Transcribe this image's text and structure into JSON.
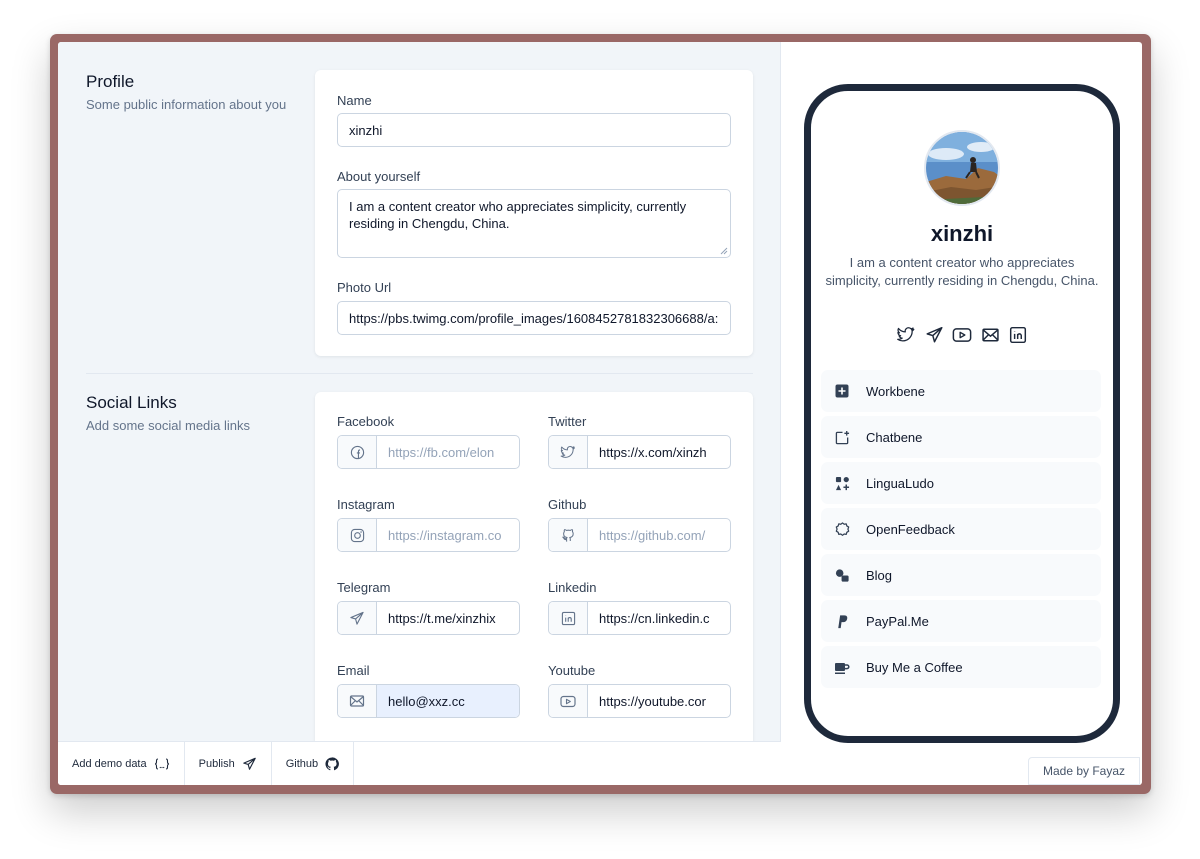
{
  "profile": {
    "title": "Profile",
    "subtitle": "Some public information about you",
    "name_label": "Name",
    "name_value": "xinzhi",
    "about_label": "About yourself",
    "about_value": "I am a content creator who appreciates simplicity, currently residing in Chengdu, China.",
    "photo_label": "Photo Url",
    "photo_value": "https://pbs.twimg.com/profile_images/1608452781832306688/a:"
  },
  "social": {
    "title": "Social Links",
    "subtitle": "Add some social media links",
    "fields": {
      "facebook": {
        "label": "Facebook",
        "value": "https://fb.com/elon",
        "icon": "facebook-icon",
        "placeholder": true
      },
      "twitter": {
        "label": "Twitter",
        "value": "https://x.com/xinzh",
        "icon": "twitter-icon",
        "placeholder": false
      },
      "instagram": {
        "label": "Instagram",
        "value": "https://instagram.co",
        "icon": "instagram-icon",
        "placeholder": true
      },
      "github": {
        "label": "Github",
        "value": "https://github.com/",
        "icon": "github-icon",
        "placeholder": true
      },
      "telegram": {
        "label": "Telegram",
        "value": "https://t.me/xinzhix",
        "icon": "telegram-icon",
        "placeholder": false
      },
      "linkedin": {
        "label": "Linkedin",
        "value": "https://cn.linkedin.c",
        "icon": "linkedin-icon",
        "placeholder": false
      },
      "email": {
        "label": "Email",
        "value": "hello@xxz.cc",
        "icon": "mail-icon",
        "placeholder": false
      },
      "youtube": {
        "label": "Youtube",
        "value": "https://youtube.cor",
        "icon": "youtube-icon",
        "placeholder": false
      }
    }
  },
  "toolbar": {
    "demo_label": "Add demo data",
    "publish_label": "Publish",
    "github_label": "Github"
  },
  "preview": {
    "name": "xinzhi",
    "bio": "I am a content creator who appreciates simplicity, currently residing in Chengdu, China.",
    "social_icons": [
      "twitter-icon",
      "telegram-icon",
      "youtube-icon",
      "mail-icon",
      "linkedin-icon"
    ],
    "links": [
      {
        "label": "Workbene",
        "icon": "plus-square-icon"
      },
      {
        "label": "Chatbene",
        "icon": "chat-add-icon"
      },
      {
        "label": "LinguaLudo",
        "icon": "shapes-icon"
      },
      {
        "label": "OpenFeedback",
        "icon": "badge-icon"
      },
      {
        "label": "Blog",
        "icon": "blog-icon"
      },
      {
        "label": "PayPal.Me",
        "icon": "paypal-icon"
      },
      {
        "label": "Buy Me a Coffee",
        "icon": "coffee-icon"
      }
    ]
  },
  "footer": {
    "made_by": "Made by Fayaz"
  },
  "colors": {
    "frame": "#9a6866",
    "phone_border": "#1e293b",
    "panel_bg": "#f1f5f9"
  }
}
